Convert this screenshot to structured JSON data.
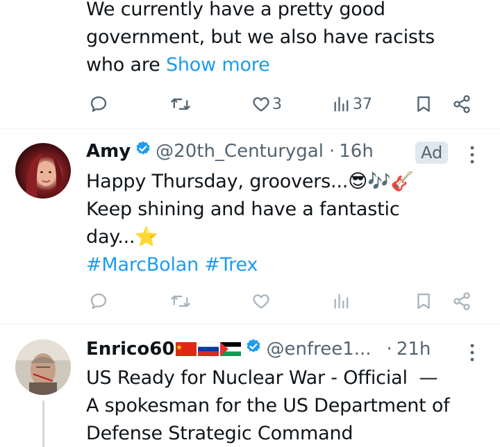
{
  "tweet1": {
    "text_lines": [
      "We currently have a pretty good",
      "government, but we also have racists",
      "who are "
    ],
    "show_more": "Show more",
    "likes": "3",
    "views": "37"
  },
  "tweet2": {
    "name": "Amy",
    "handle": "@20th_Centurygal",
    "separator": "·",
    "time": "16h",
    "ad_label": "Ad",
    "line1": "Happy Thursday, groovers...😎🎶🎸",
    "line2": "Keep shining and have a fantastic",
    "line3": "day...⭐",
    "hashtags": "#MarcBolan #Trex"
  },
  "tweet3": {
    "name": "Enrico60",
    "handle": "@enfree1...",
    "separator": "·",
    "time": "21h",
    "text_lines": [
      "US Ready for Nuclear War - Official  —",
      "A spokesman for the US Department of",
      "Defense Strategic Command"
    ]
  },
  "colors": {
    "accent": "#1d9bf0",
    "secondary_text": "#536471",
    "verified": "#1d9bf0"
  }
}
